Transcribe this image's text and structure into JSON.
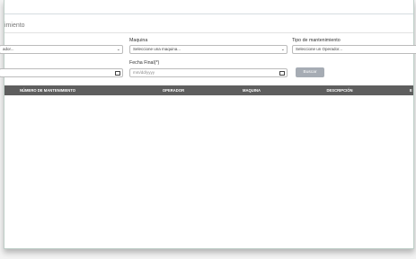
{
  "page": {
    "title": "imiento"
  },
  "filters": {
    "operador": {
      "value": "ador..."
    },
    "maquina": {
      "label": "Maquina",
      "value": "Seleccione una maquina..."
    },
    "tipo": {
      "label": "Tipo de mantenimiento",
      "value": "Seleccione un Operador..."
    },
    "fecha_final": {
      "label": "Fecha Final(*)",
      "placeholder": "mm/dd/yyyy"
    }
  },
  "search_button": {
    "label": "Buscar"
  },
  "table": {
    "columns": [
      "NÚMERO DE MANTENIMIENTO",
      "OPERADOR",
      "MAQUINA",
      "DESCRIPCIÓN",
      "E"
    ]
  },
  "colors": {
    "header_bg": "#5e5e5e",
    "button_bg": "#a6acb4"
  }
}
